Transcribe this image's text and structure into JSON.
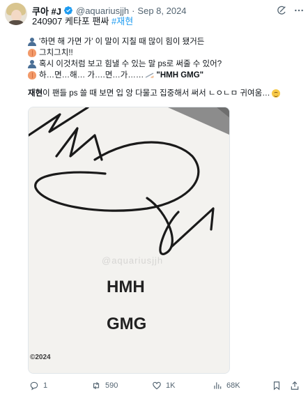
{
  "author": {
    "display_name": "쿠아 #J",
    "handle": "@aquariusjjh",
    "separator": "·",
    "date": "Sep 8, 2024"
  },
  "subtitle": {
    "text": "240907 케타포 팬싸 ",
    "hashtag": "#재현"
  },
  "body": {
    "lines": [
      {
        "emoji": "person",
        "text": "'하면 해 가면 가' 이 말이 지칠 때 많이 힘이 됐거든"
      },
      {
        "emoji": "peach",
        "text": "그치그치!!"
      },
      {
        "emoji": "person",
        "text": "혹시 이것처럼 보고 힘낼 수 있는 말 ps로 써줄 수 있어?"
      },
      {
        "emoji": "peach",
        "text_before": "하…면…해… 가….면…가……",
        "text_after": " \"HMH GMG\""
      }
    ],
    "comment_bold": "재현",
    "comment_rest": "이 팬들 ps 쓸 때 보면 입 앙 다물고 집중해서 써서 ㄴㅇㄴㅁ 귀여움…"
  },
  "media": {
    "watermark": "@aquariusjjh",
    "caption": "©2024",
    "handwriting_line1": "HMH",
    "handwriting_line2": "GMG"
  },
  "actions": {
    "replies": "1",
    "retweets": "590",
    "likes": "1K",
    "views": "68K"
  },
  "colors": {
    "link": "#1d9bf0",
    "verified": "#1d9bf0",
    "muted": "#536471"
  }
}
